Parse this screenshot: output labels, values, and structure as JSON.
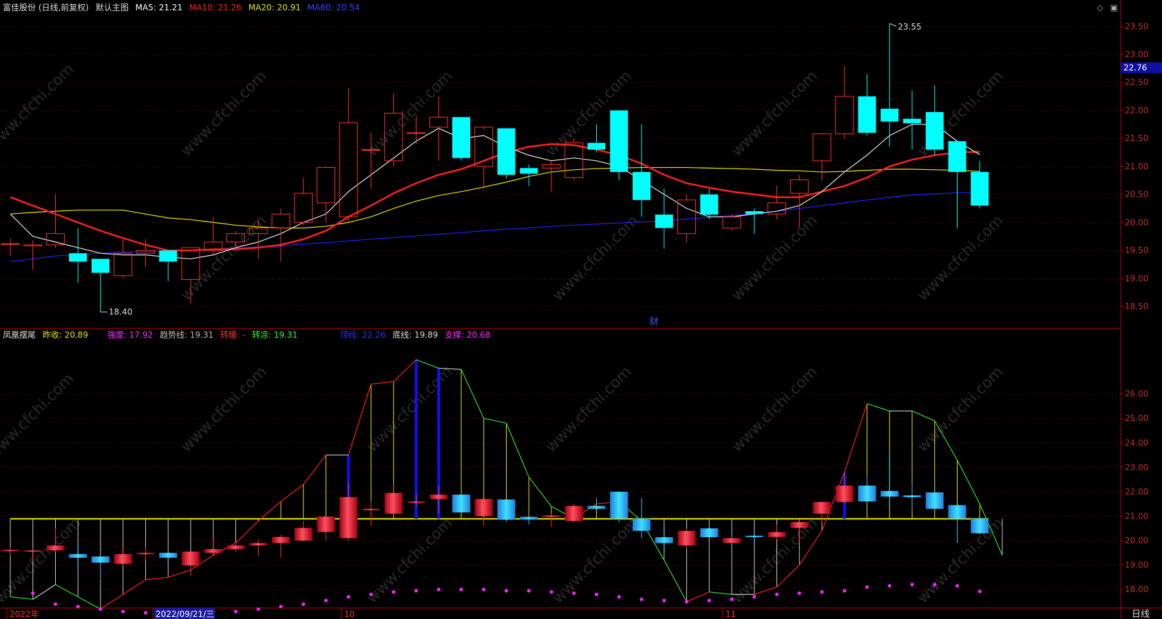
{
  "main_header": {
    "stock_title": "富佳股份 (日线,前复权)",
    "template_label": "默认主图",
    "ma5": "MA5: 21.21",
    "ma10": "MA10: 21.26",
    "ma20": "MA20: 20.91",
    "ma60": "MA60: 20.54"
  },
  "sub_header": {
    "indicator_name": "凤凰摆尾",
    "prev_close": "昨收: 20.89",
    "strength": "强度: 17.92",
    "trend": "趋势线: 19.31",
    "turn_warm": "转暖: -",
    "turn_cool": "转凉: 19.31",
    "top_line": "顶线: 22.26",
    "bottom_line": "底线: 19.89",
    "support": "支撑: 20.68"
  },
  "markers": {
    "high": "23.55",
    "low": "18.40",
    "last_price": "22.76",
    "finance_mark": "财"
  },
  "time_axis": [
    "2022年",
    "2022/09/21/三",
    "10",
    "11"
  ],
  "period_label": "日线",
  "watermark": "www.cfchi.com",
  "colors": {
    "up": "#ff3030",
    "down": "#00ffff",
    "ma5": "#e8e8e8",
    "ma10": "#ff2020",
    "ma20": "#e8e800",
    "ma60": "#2020ff",
    "grid": "#5a0000",
    "axis": "#c00000"
  },
  "chart_data": [
    {
      "type": "candlestick",
      "title": "默认主图",
      "ylim": [
        18.2,
        23.7
      ],
      "y_ticks": [
        18.5,
        19.0,
        19.5,
        20.0,
        20.5,
        21.0,
        21.5,
        22.0,
        22.5,
        23.0,
        23.5
      ],
      "candles": [
        {
          "o": 19.62,
          "h": 19.72,
          "l": 19.4,
          "c": 19.62
        },
        {
          "o": 19.58,
          "h": 19.68,
          "l": 19.15,
          "c": 19.6
        },
        {
          "o": 19.6,
          "h": 20.5,
          "l": 19.55,
          "c": 19.8
        },
        {
          "o": 19.45,
          "h": 19.9,
          "l": 18.92,
          "c": 19.3
        },
        {
          "o": 19.35,
          "h": 19.35,
          "l": 18.4,
          "c": 19.1
        },
        {
          "o": 19.05,
          "h": 19.7,
          "l": 19.0,
          "c": 19.45
        },
        {
          "o": 19.45,
          "h": 19.7,
          "l": 19.2,
          "c": 19.5
        },
        {
          "o": 19.5,
          "h": 19.5,
          "l": 18.95,
          "c": 19.3
        },
        {
          "o": 18.98,
          "h": 19.55,
          "l": 18.55,
          "c": 19.55
        },
        {
          "o": 19.5,
          "h": 20.1,
          "l": 19.4,
          "c": 19.65
        },
        {
          "o": 19.65,
          "h": 19.85,
          "l": 19.55,
          "c": 19.8
        },
        {
          "o": 19.8,
          "h": 20.05,
          "l": 19.35,
          "c": 19.9
        },
        {
          "o": 19.9,
          "h": 20.25,
          "l": 19.3,
          "c": 20.15
        },
        {
          "o": 20.0,
          "h": 20.8,
          "l": 19.95,
          "c": 20.52
        },
        {
          "o": 20.35,
          "h": 21.0,
          "l": 20.0,
          "c": 20.98
        },
        {
          "o": 20.1,
          "h": 22.4,
          "l": 20.0,
          "c": 21.78
        },
        {
          "o": 21.3,
          "h": 21.6,
          "l": 20.6,
          "c": 21.3
        },
        {
          "o": 21.1,
          "h": 22.3,
          "l": 21.0,
          "c": 21.95
        },
        {
          "o": 21.6,
          "h": 21.9,
          "l": 21.4,
          "c": 21.6
        },
        {
          "o": 21.7,
          "h": 22.25,
          "l": 21.1,
          "c": 21.88
        },
        {
          "o": 21.88,
          "h": 21.88,
          "l": 21.1,
          "c": 21.15
        },
        {
          "o": 21.0,
          "h": 21.65,
          "l": 20.6,
          "c": 21.7
        },
        {
          "o": 21.68,
          "h": 21.68,
          "l": 20.78,
          "c": 20.85
        },
        {
          "o": 20.97,
          "h": 21.03,
          "l": 20.65,
          "c": 20.87
        },
        {
          "o": 20.97,
          "h": 21.1,
          "l": 20.55,
          "c": 21.03
        },
        {
          "o": 20.8,
          "h": 21.5,
          "l": 20.75,
          "c": 21.42
        },
        {
          "o": 21.42,
          "h": 21.75,
          "l": 21.25,
          "c": 21.3
        },
        {
          "o": 22.0,
          "h": 22.0,
          "l": 20.75,
          "c": 20.9
        },
        {
          "o": 20.9,
          "h": 21.75,
          "l": 20.1,
          "c": 20.4
        },
        {
          "o": 20.14,
          "h": 20.6,
          "l": 19.53,
          "c": 19.9
        },
        {
          "o": 19.8,
          "h": 20.5,
          "l": 19.65,
          "c": 20.4
        },
        {
          "o": 20.5,
          "h": 20.6,
          "l": 20.06,
          "c": 20.14
        },
        {
          "o": 19.9,
          "h": 20.15,
          "l": 19.85,
          "c": 20.1
        },
        {
          "o": 20.2,
          "h": 20.25,
          "l": 19.8,
          "c": 20.15
        },
        {
          "o": 20.15,
          "h": 20.65,
          "l": 20.05,
          "c": 20.35
        },
        {
          "o": 20.52,
          "h": 20.85,
          "l": 19.9,
          "c": 20.76
        },
        {
          "o": 21.1,
          "h": 21.6,
          "l": 20.75,
          "c": 21.58
        },
        {
          "o": 21.58,
          "h": 22.8,
          "l": 21.5,
          "c": 22.25
        },
        {
          "o": 22.25,
          "h": 22.65,
          "l": 21.55,
          "c": 21.6
        },
        {
          "o": 22.03,
          "h": 23.55,
          "l": 21.35,
          "c": 21.8
        },
        {
          "o": 21.85,
          "h": 22.35,
          "l": 21.3,
          "c": 21.77
        },
        {
          "o": 21.97,
          "h": 22.45,
          "l": 21.2,
          "c": 21.3
        },
        {
          "o": 21.45,
          "h": 21.45,
          "l": 19.9,
          "c": 20.9
        },
        {
          "o": 20.9,
          "h": 21.1,
          "l": 20.25,
          "c": 20.3
        }
      ],
      "ma5": [
        20.15,
        19.75,
        19.65,
        19.55,
        19.45,
        19.42,
        19.42,
        19.38,
        19.35,
        19.42,
        19.55,
        19.65,
        19.8,
        20.0,
        20.15,
        20.55,
        20.85,
        21.15,
        21.45,
        21.68,
        21.5,
        21.55,
        21.35,
        21.2,
        21.1,
        21.15,
        21.1,
        21.0,
        20.75,
        20.5,
        20.25,
        20.1,
        20.1,
        20.15,
        20.2,
        20.3,
        20.55,
        20.9,
        21.2,
        21.55,
        21.75,
        21.75,
        21.45,
        21.21
      ],
      "ma10": [
        20.45,
        20.3,
        20.15,
        20.0,
        19.85,
        19.72,
        19.6,
        19.5,
        19.5,
        19.52,
        19.52,
        19.55,
        19.6,
        19.7,
        19.85,
        20.1,
        20.3,
        20.52,
        20.7,
        20.85,
        20.95,
        21.1,
        21.25,
        21.35,
        21.4,
        21.38,
        21.3,
        21.2,
        21.05,
        20.85,
        20.7,
        20.62,
        20.55,
        20.5,
        20.45,
        20.45,
        20.55,
        20.65,
        20.8,
        21.0,
        21.12,
        21.2,
        21.25,
        21.26
      ],
      "ma20": [
        20.15,
        20.18,
        20.2,
        20.22,
        20.22,
        20.22,
        20.15,
        20.08,
        20.05,
        20.0,
        19.95,
        19.92,
        19.9,
        19.9,
        19.93,
        20.0,
        20.1,
        20.25,
        20.38,
        20.48,
        20.55,
        20.63,
        20.72,
        20.82,
        20.9,
        20.94,
        20.96,
        20.97,
        20.98,
        20.98,
        20.98,
        20.97,
        20.96,
        20.95,
        20.93,
        20.92,
        20.9,
        20.91,
        20.93,
        20.95,
        20.95,
        20.94,
        20.93,
        20.91
      ],
      "ma60": [
        19.3,
        19.35,
        19.4,
        19.43,
        19.45,
        19.47,
        19.48,
        19.49,
        19.5,
        19.52,
        19.54,
        19.56,
        19.58,
        19.61,
        19.64,
        19.67,
        19.7,
        19.73,
        19.76,
        19.79,
        19.82,
        19.85,
        19.88,
        19.9,
        19.93,
        19.95,
        19.97,
        19.99,
        20.01,
        20.03,
        20.06,
        20.09,
        20.12,
        20.16,
        20.2,
        20.25,
        20.3,
        20.35,
        20.4,
        20.45,
        20.49,
        20.51,
        20.53,
        20.54
      ]
    },
    {
      "type": "indicator",
      "title": "凤凰摆尾",
      "ylim": [
        17.3,
        28.1
      ],
      "y_ticks": [
        18.0,
        19.0,
        20.0,
        21.0,
        22.0,
        23.0,
        24.0,
        25.0,
        26.0
      ],
      "prev_close_line": 20.89,
      "trend_line": [
        17.7,
        17.6,
        18.2,
        17.7,
        17.2,
        17.8,
        18.4,
        18.5,
        18.8,
        19.4,
        19.9,
        20.8,
        21.6,
        22.3,
        23.5,
        23.5,
        26.4,
        26.5,
        27.4,
        27.05,
        27.0,
        25.0,
        24.8,
        22.6,
        21.4,
        20.9,
        21.5,
        21.6,
        20.8,
        19.2,
        17.5,
        17.9,
        17.8,
        17.8,
        18.1,
        19.0,
        20.4,
        22.8,
        25.6,
        25.3,
        25.3,
        24.9,
        23.3,
        21.5,
        19.4
      ],
      "up_thrust_bars": [
        15,
        18,
        19,
        37
      ],
      "strength_dots": [
        17.85,
        17.4,
        17.3,
        17.2,
        17.1,
        17.05,
        17.0,
        17.0,
        17.05,
        17.1,
        17.2,
        17.3,
        17.4,
        17.55,
        17.7,
        17.8,
        17.9,
        17.95,
        18.0,
        18.0,
        18.0,
        17.95,
        17.95,
        17.9,
        17.85,
        17.8,
        17.7,
        17.6,
        17.55,
        17.5,
        17.55,
        17.6,
        17.7,
        17.8,
        17.85,
        17.9,
        17.95,
        18.1,
        18.15,
        18.2,
        18.2,
        18.15,
        17.92
      ]
    }
  ]
}
